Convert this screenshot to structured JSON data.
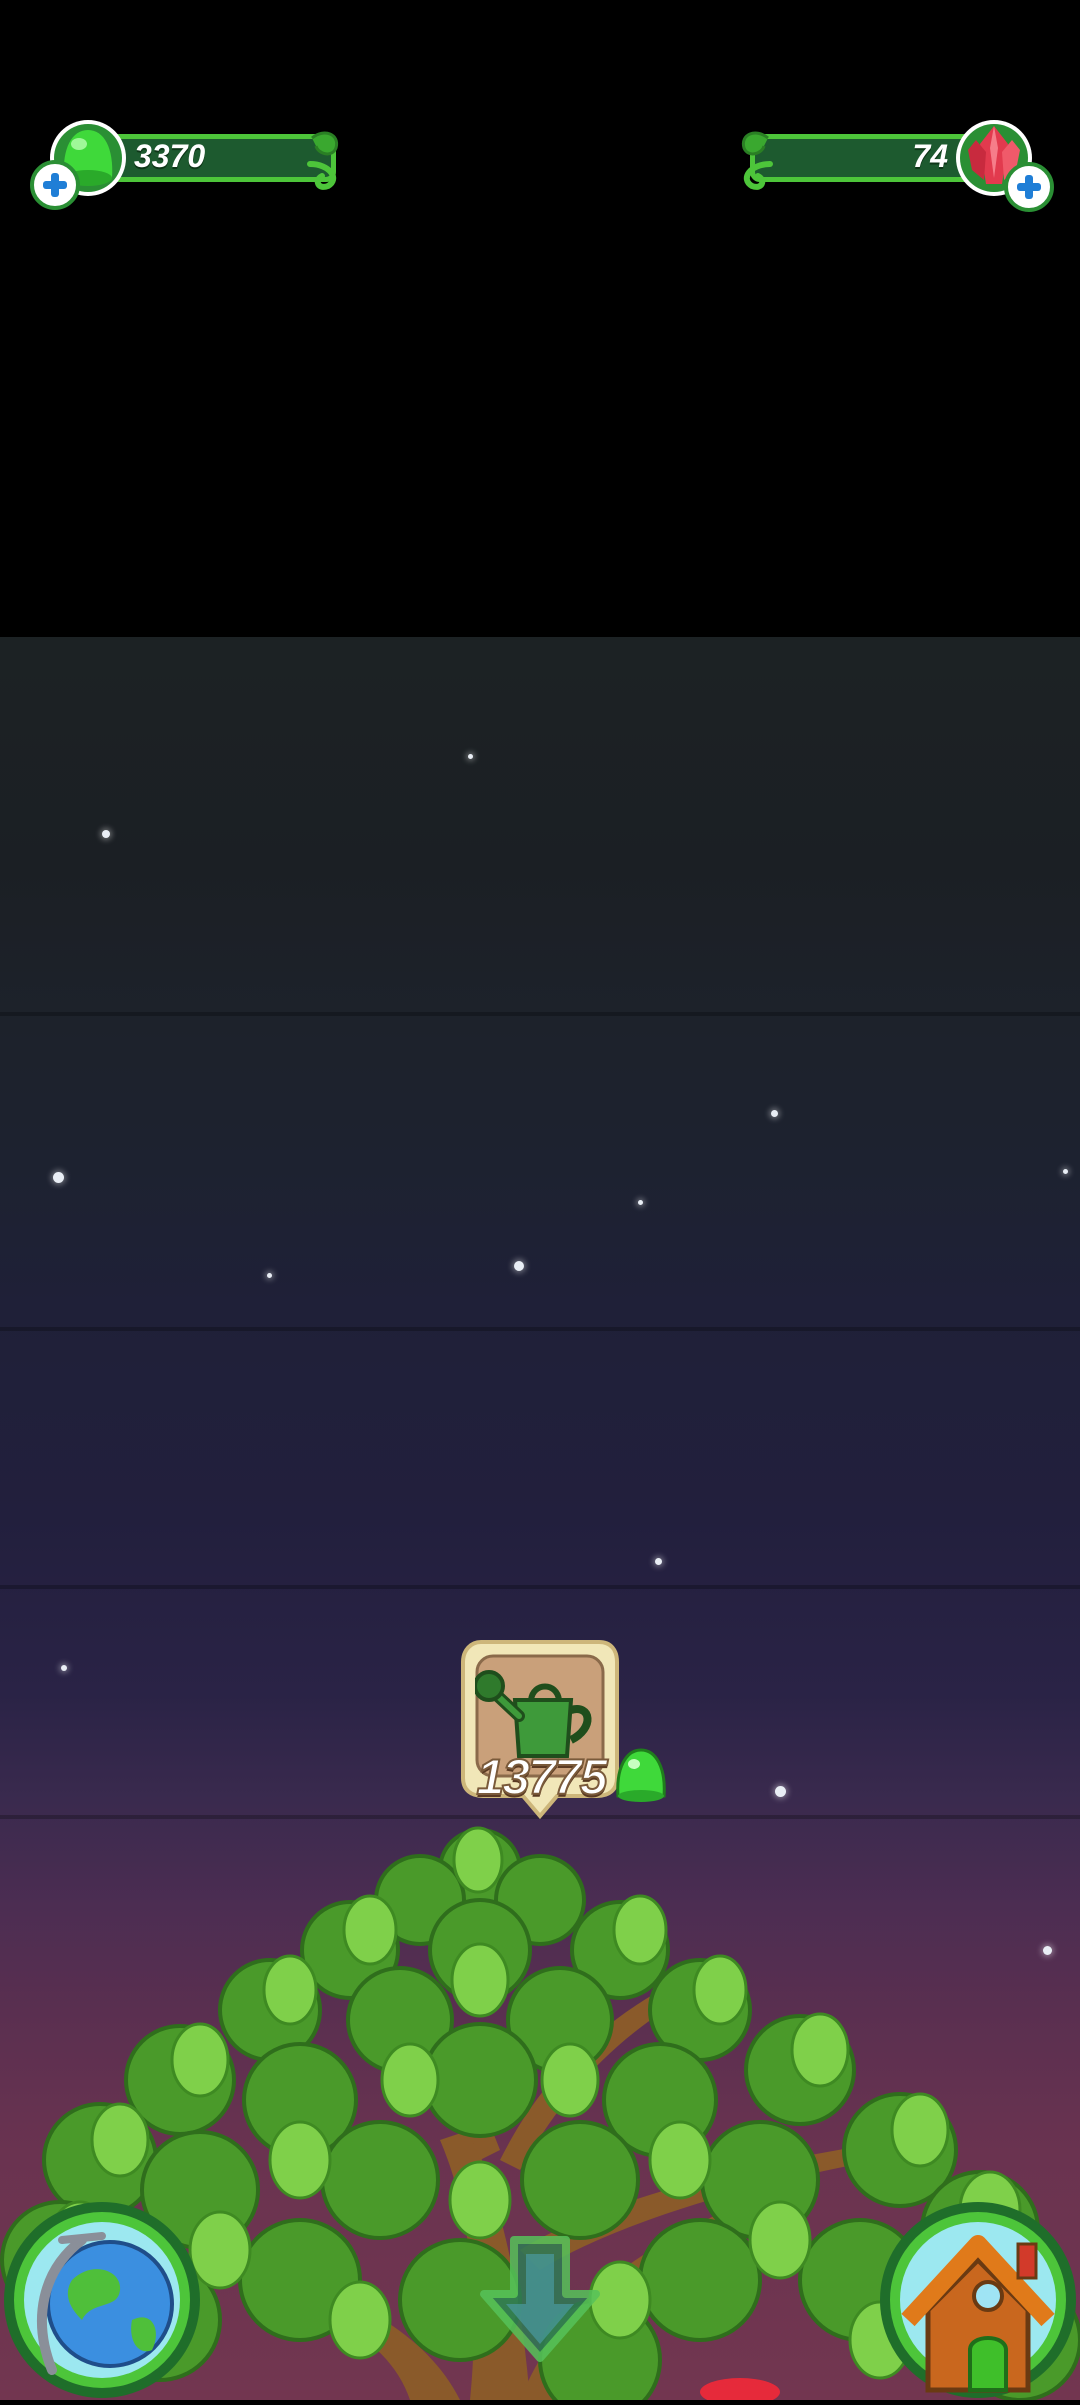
{
  "hud": {
    "left_value": "3370",
    "right_value": "74",
    "left_icon": "green-gumdrop-icon",
    "right_icon": "red-crystal-icon"
  },
  "tree_badge": {
    "value": "13775",
    "icon": "watering-can-icon",
    "currency_icon": "green-gumdrop-icon"
  },
  "buttons": {
    "left": "globe-icon",
    "center": "down-arrow-icon",
    "right": "house-icon"
  },
  "colors": {
    "hud_green": "#4dc53a",
    "hud_fill": "#1d5a2f",
    "gem_red": "#e23a4e",
    "plus_blue": "#1f7ed6"
  }
}
